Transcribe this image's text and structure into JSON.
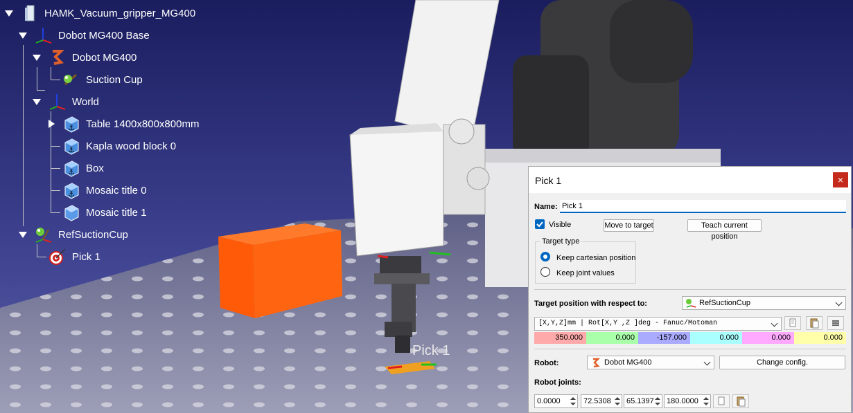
{
  "tree": {
    "station": "HAMK_Vacuum_gripper_MG400",
    "base": "Dobot MG400 Base",
    "robot": "Dobot MG400",
    "tool": "Suction Cup",
    "world": "World",
    "objects": [
      "Table 1400x800x800mm",
      "Kapla wood block 0",
      "Box",
      "Mosaic title 0",
      "Mosaic title 1"
    ],
    "ref_frame": "RefSuctionCup",
    "target": "Pick 1"
  },
  "scene": {
    "target_label": "Pick 1"
  },
  "dialog": {
    "title": "Pick 1",
    "close_label": "×",
    "name_label": "Name:",
    "name_value": "Pick 1",
    "visible_label": "Visible",
    "visible_checked": true,
    "move_to_target_label": "Move to target",
    "teach_label": "Teach current position",
    "target_type_label": "Target type",
    "keep_cartesian_label": "Keep cartesian position",
    "keep_joint_label": "Keep joint values",
    "selected_target_type": "Keep cartesian position",
    "respect_label": "Target position with respect to:",
    "respect_value": "RefSuctionCup",
    "format_value": "[X,Y,Z]mm | Rot[X,Y ,Z  ]deg - Fanuc/Motoman",
    "position_values": [
      "350.000",
      "0.000",
      "-157.000",
      "0.000",
      "0.000",
      "0.000"
    ],
    "position_colors": [
      "#ffaaaa",
      "#aaffaa",
      "#aaaaff",
      "#aaffff",
      "#ffaaff",
      "#ffffaa"
    ],
    "robot_label": "Robot:",
    "robot_value": "Dobot MG400",
    "change_config_label": "Change config.",
    "joints_label": "Robot joints:",
    "joint_values": [
      "0.0000",
      "72.5308",
      "65.1397",
      "180.0000"
    ]
  }
}
